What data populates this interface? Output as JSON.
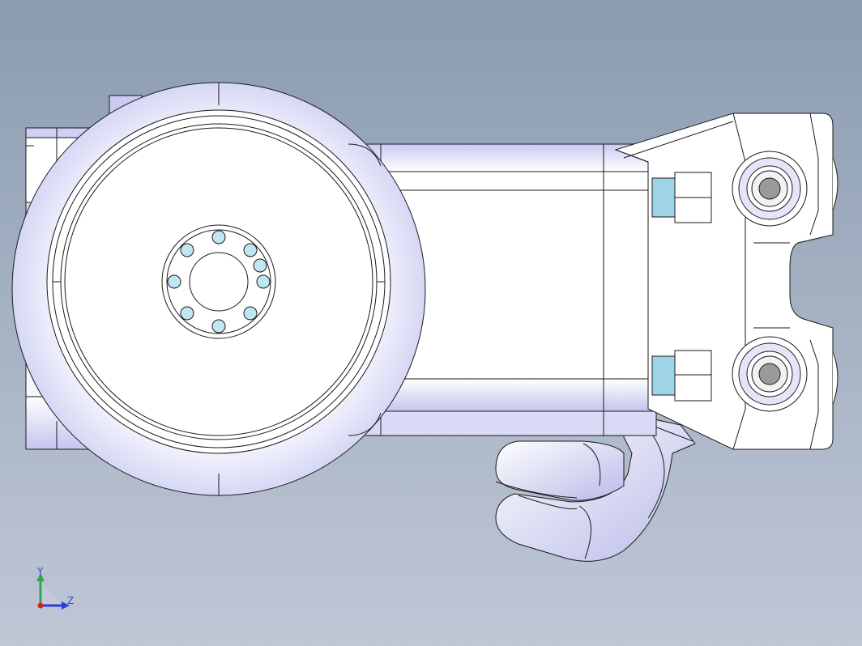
{
  "viewport": {
    "background_top": "#8b9bb0",
    "background_bottom": "#bfc7d5",
    "model_fill": "#ffffff",
    "model_shade": "#c8caf0",
    "edge_color": "#1a1a1a",
    "bolt_color": "#bfe6f2",
    "pin_color": "#9a9a98",
    "spacer_color": "#9fd4e6"
  },
  "triad": {
    "y_label": "Y",
    "z_label": "Z",
    "y_color": "#2fa84a",
    "z_color": "#2b3fd6",
    "x_color": "#d62020",
    "icons": [
      "y-axis-arrow-icon",
      "z-axis-arrow-icon",
      "x-axis-dot-icon"
    ]
  }
}
